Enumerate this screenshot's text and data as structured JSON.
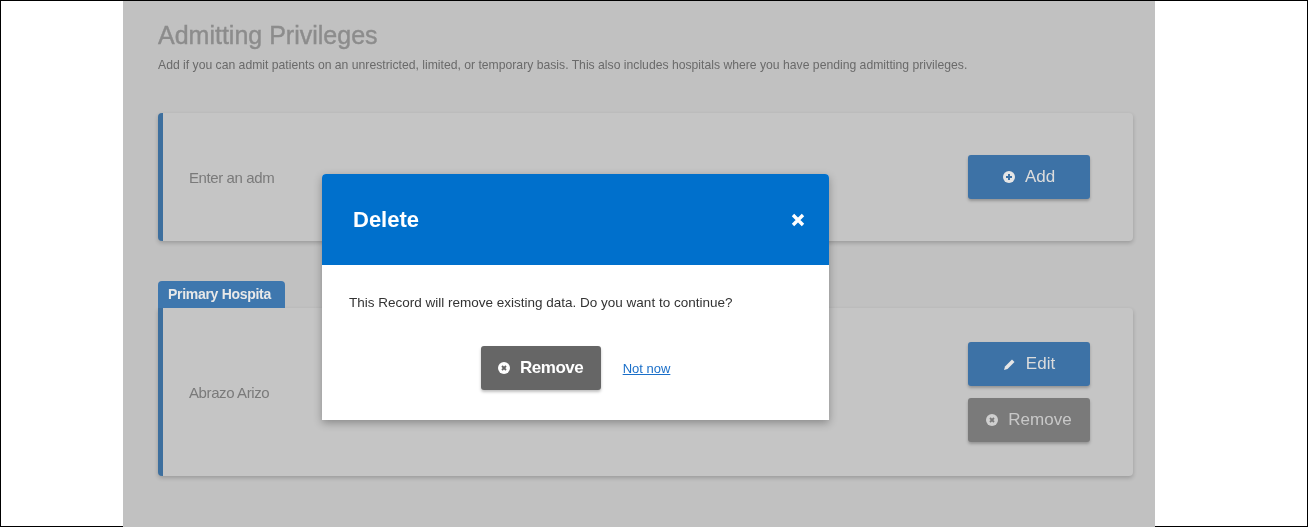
{
  "section": {
    "title": "Admitting Privileges",
    "description": "Add if you can admit patients on an unrestricted, limited, or temporary basis. This also includes hospitals where you have pending admitting privileges."
  },
  "entry_card": {
    "prompt": "Enter an adm",
    "buttons": [
      {
        "label": "Add",
        "kind": "add"
      }
    ]
  },
  "hospital_card": {
    "tab": "Primary Hospita",
    "name": "Abrazo Arizo",
    "buttons": [
      {
        "label": "Edit",
        "kind": "edit"
      },
      {
        "label": "Remove",
        "kind": "remove"
      }
    ]
  },
  "dialog": {
    "title": "Delete",
    "message": "This Record will remove existing data. Do you want to continue?",
    "buttons": [
      {
        "label": "Remove",
        "kind": "remove"
      },
      {
        "label": "Not now",
        "kind": "link"
      }
    ]
  }
}
